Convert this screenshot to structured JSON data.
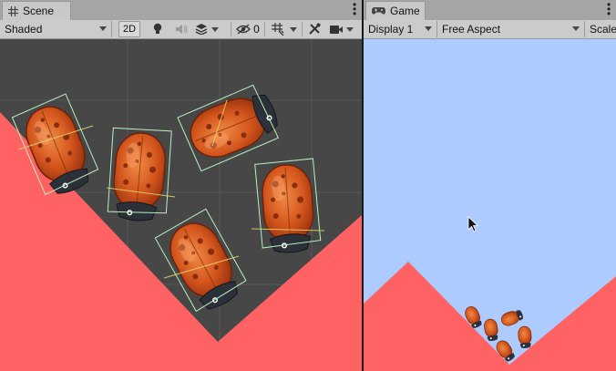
{
  "scene": {
    "tab_label": "Scene",
    "shading_mode": "Shaded",
    "mode_2d_label": "2D",
    "hidden_count": "0",
    "icons": [
      "grid-icon",
      "kebab-menu-icon",
      "lightbulb-icon",
      "audio-icon",
      "effects-icon",
      "visibility-icon",
      "grid-snap-icon",
      "tools-icon",
      "camera-icon"
    ]
  },
  "game": {
    "tab_label": "Game",
    "display": "Display 1",
    "aspect": "Free Aspect",
    "scale_label": "Scale",
    "icons": [
      "gamepad-icon",
      "kebab-menu-icon",
      "mouse-cursor-icon"
    ]
  },
  "colors": {
    "scene_background": "#474747",
    "game_sky": "#aecbff",
    "ground": "#ff6262",
    "ladybug_shell": "#c84a17",
    "ladybug_head": "#2c3038",
    "collider_outline": "#b8f0c0",
    "grid_line": "#575757"
  }
}
